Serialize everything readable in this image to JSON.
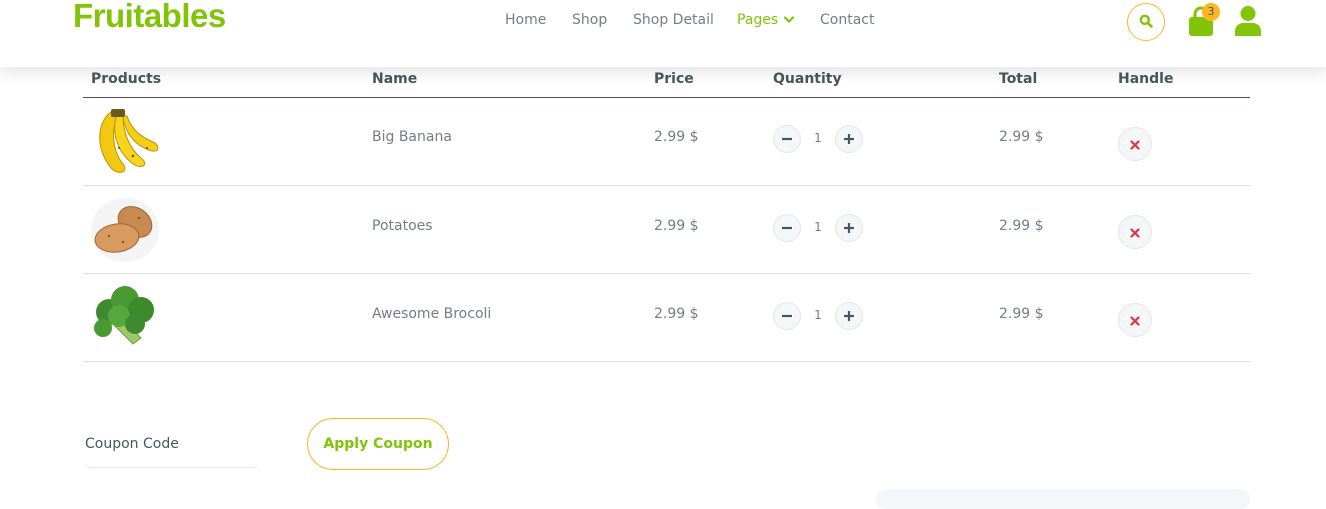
{
  "brand": {
    "name": "Fruitables",
    "color": "#81c408"
  },
  "nav": {
    "items": [
      {
        "label": "Home",
        "active": false
      },
      {
        "label": "Shop",
        "active": false
      },
      {
        "label": "Shop Detail",
        "active": false
      },
      {
        "label": "Pages",
        "active": true,
        "icon": "chevron-down-icon"
      },
      {
        "label": "Contact",
        "active": false
      }
    ]
  },
  "header_actions": {
    "search_icon": "search-icon",
    "cart_icon": "shopping-bag-icon",
    "cart_count": "3",
    "user_icon": "user-icon"
  },
  "cart_table": {
    "headers": [
      "Products",
      "Name",
      "Price",
      "Quantity",
      "Total",
      "Handle"
    ],
    "rows": [
      {
        "image": "banana-image",
        "name": "Big Banana",
        "price": "2.99 $",
        "quantity": "1",
        "total": "2.99 $"
      },
      {
        "image": "potatoes-image",
        "name": "Potatoes",
        "price": "2.99 $",
        "quantity": "1",
        "total": "2.99 $"
      },
      {
        "image": "broccoli-image",
        "name": "Awesome Brocoli",
        "price": "2.99 $",
        "quantity": "1",
        "total": "2.99 $"
      }
    ]
  },
  "coupon": {
    "placeholder": "Coupon Code",
    "value": "",
    "button_label": "Apply Coupon"
  },
  "colors": {
    "primary": "#81c408",
    "secondary": "#ffb524",
    "dark": "#45595b",
    "danger": "#dc3545",
    "text": "#747d88"
  }
}
